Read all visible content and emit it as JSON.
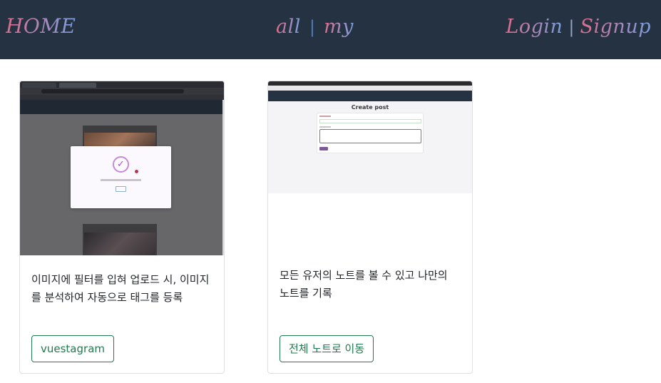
{
  "navbar": {
    "home": "HOME",
    "center_links": [
      "all",
      "my"
    ],
    "separator": "|",
    "auth_links": [
      "Login",
      "Signup"
    ],
    "gradient_colors": [
      "#e06d8c",
      "#7a9fe0"
    ],
    "background": "#253241"
  },
  "cards": [
    {
      "description": "이미지에 필터를 입혀 업로드 시, 이미지를 분석하여 자동으로 태그를 등록",
      "button_label": "vuestagram"
    },
    {
      "description": "모든 유저의 노트를 볼 수 있고 나만의 노트를 기록",
      "button_label": "전체 노트로 이동",
      "screenshot_title": "Create post"
    }
  ],
  "accent_color": "#1f7a4d"
}
